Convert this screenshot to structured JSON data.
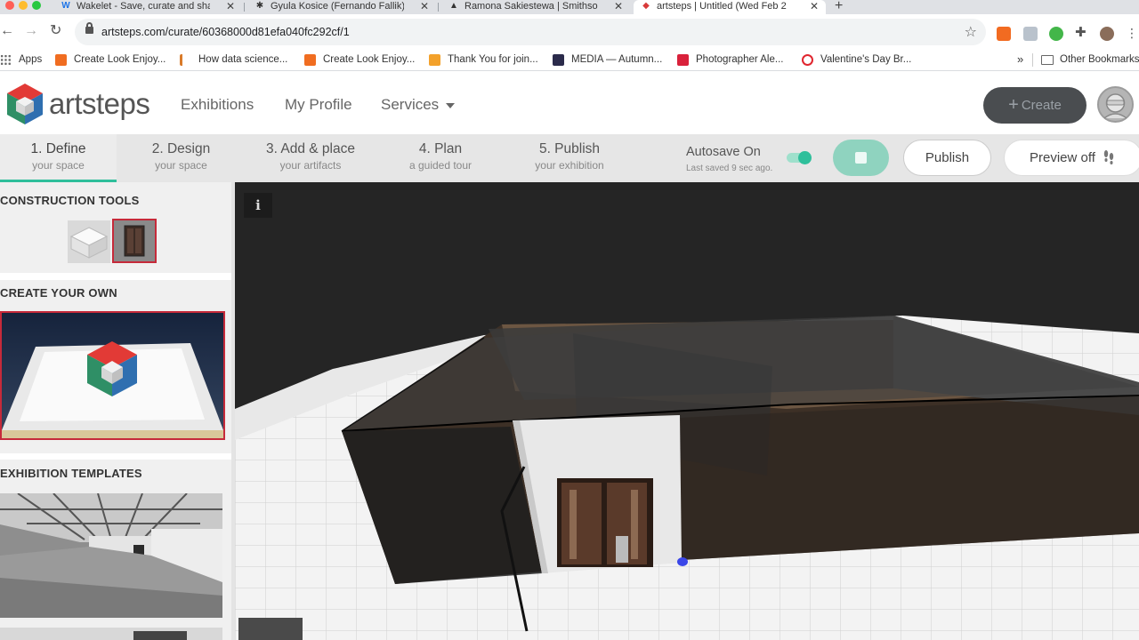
{
  "browser": {
    "tabs": [
      {
        "title": "Wakelet - Save, curate and sha",
        "favicon": "W",
        "color": "#1e74e8",
        "active": false
      },
      {
        "title": "Gyula Kosice (Fernando Fallik)",
        "favicon": "✱",
        "color": "#222222",
        "active": false
      },
      {
        "title": "Ramona Sakiestewa | Smithsonian",
        "favicon": "▲",
        "color": "#222222",
        "active": false
      },
      {
        "title": "artsteps | Untitled (Wed Feb 2",
        "favicon": "◆",
        "color": "#d83a3a",
        "active": true
      }
    ],
    "tab_close": "✕",
    "new_tab": "+",
    "url": "artsteps.com/curate/60368000d81efa040fc292cf/1",
    "nav": {
      "back": "←",
      "forward": "→",
      "reload": "↻"
    },
    "bookmark_star": "☆",
    "bookmarks": [
      {
        "label": "Apps",
        "icon": "apps-grid-icon",
        "color": "#666666"
      },
      {
        "label": "Create Look Enjoy...",
        "icon": "blogger-icon",
        "color": "#f06d21"
      },
      {
        "label": "How data science...",
        "icon": "bookmark-icon",
        "color": "#d97b2a"
      },
      {
        "label": "Create Look Enjoy...",
        "icon": "blogger-icon",
        "color": "#f06d21"
      },
      {
        "label": "Thank You for join...",
        "icon": "bookmark-icon",
        "color": "#f3a12b"
      },
      {
        "label": "MEDIA — Autumn...",
        "icon": "media-icon",
        "color": "#2b2b4b"
      },
      {
        "label": "Photographer Ale...",
        "icon": "h-icon",
        "color": "#d9213b"
      },
      {
        "label": "Valentine's Day Br...",
        "icon": "e-icon",
        "color": "#e0262f"
      }
    ],
    "more_bookmarks": "»",
    "other_bookmarks": "Other Bookmarks"
  },
  "app": {
    "logo_text": "artsteps",
    "nav": {
      "exhibitions": "Exhibitions",
      "my_profile": "My Profile",
      "services": "Services"
    },
    "create_label": "Create",
    "create_plus": "+",
    "steps": [
      {
        "title": "1. Define",
        "sub": "your space",
        "active": true
      },
      {
        "title": "2. Design",
        "sub": "your space",
        "active": false
      },
      {
        "title": "3. Add & place",
        "sub": "your artifacts",
        "active": false
      },
      {
        "title": "4. Plan",
        "sub": "a guided tour",
        "active": false
      },
      {
        "title": "5. Publish",
        "sub": "your exhibition",
        "active": false
      }
    ],
    "autosave": {
      "label": "Autosave On",
      "sub": "Last saved 9 sec ago.",
      "enabled": true
    },
    "publish_label": "Publish",
    "preview_label": "Preview off",
    "accent": "#2fbf9b"
  },
  "sidebar": {
    "construction_tools": "CONSTRUCTION TOOLS",
    "create_your_own": "CREATE YOUR OWN",
    "exhibition_templates": "EXHIBITION TEMPLATES"
  },
  "canvas": {
    "info": "i"
  }
}
